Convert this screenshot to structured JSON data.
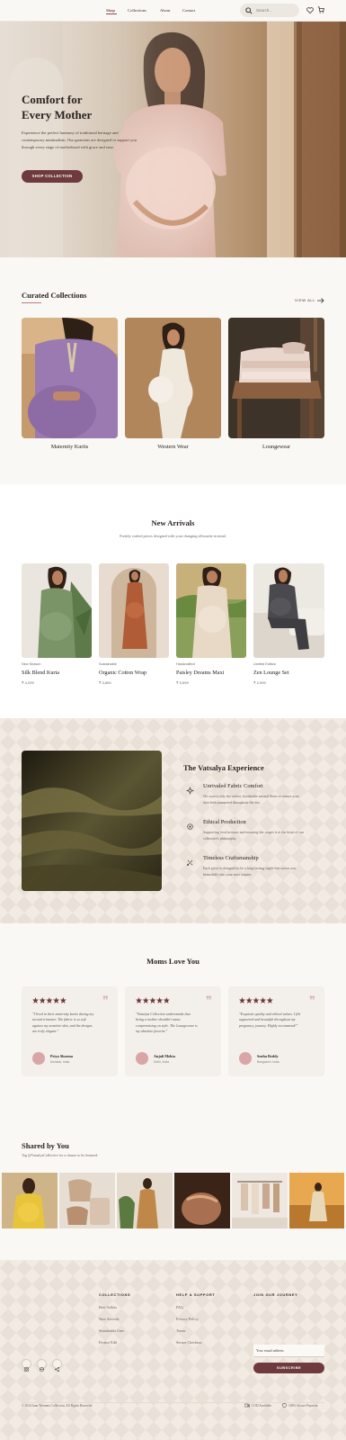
{
  "nav": {
    "items": [
      {
        "label": "Shop"
      },
      {
        "label": "Collections"
      },
      {
        "label": "About"
      },
      {
        "label": "Contact"
      }
    ],
    "search_placeholder": "Search..."
  },
  "hero": {
    "title_line1": "Comfort for",
    "title_line2": "Every Mother",
    "subtitle_line1": "Experience the perfect harmony of traditional heritage and",
    "subtitle_line2": "contemporary minimalism. Our garments are designed to support you",
    "subtitle_line3": "through every stage of motherhood with grace and ease.",
    "cta": "SHOP COLLECTION"
  },
  "curated": {
    "title": "Curated Collections",
    "view_all": "VIEW ALL",
    "items": [
      {
        "label": "Maternity Kurtis"
      },
      {
        "label": "Western Wear"
      },
      {
        "label": "Loungewear"
      }
    ]
  },
  "arrivals": {
    "title": "New Arrivals",
    "subtitle": "Freshly crafted pieces designed with your changing silhouette in mind.",
    "products": [
      {
        "tag": "New Season",
        "name": "Silk Blend Kurta",
        "price": "₹ 4,299"
      },
      {
        "tag": "Sustainable",
        "name": "Organic Cotton Wrap",
        "price": "₹ 3,850"
      },
      {
        "tag": "Handcrafted",
        "name": "Paisley Dreams Maxi",
        "price": "₹ 5,599"
      },
      {
        "tag": "Limited Edition",
        "name": "Zen Lounge Set",
        "price": "₹ 2,999"
      }
    ]
  },
  "experience": {
    "title": "The Vatsalya Experience",
    "features": [
      {
        "icon": "sparkle-icon",
        "title": "Unrivaled Fabric Comfort",
        "text1": "We source only the softest, breathable natural fibers to ensure your",
        "text2": "skin feels pampered throughout the day."
      },
      {
        "icon": "leaf-icon",
        "title": "Ethical Production",
        "text1": "Supporting local artisans and ensuring fair wages is at the heart of our",
        "text2": "collective's philosophy."
      },
      {
        "icon": "craft-icon",
        "title": "Timeless Craftsmanship",
        "text1": "Each piece is designed to be a long-lasting staple that serves you",
        "text2": "beautifully into your next chapter."
      }
    ]
  },
  "testimonials": {
    "title": "Moms Love You",
    "items": [
      {
        "q1": "\"I lived in their maternity kurtis during my",
        "q2": "second trimester. The fabric is so soft",
        "q3": "against my sensitive skin, and the designs",
        "q4": "are truly elegant.\"",
        "name": "Priya Sharma",
        "loc": "Mumbai, India"
      },
      {
        "q1": "\"Vatsalya Collection understands that",
        "q2": "being a mother shouldn't mean",
        "q3": "compromising on style. The Loungewear is",
        "q4": "my absolute favorite.\"",
        "name": "Anjali Mehta",
        "loc": "Delhi, India"
      },
      {
        "q1": "\"Exquisite quality and ethical values. I felt",
        "q2": "supported and beautiful throughout my",
        "q3": "pregnancy journey. Highly recommend!\"",
        "q4": "",
        "name": "Sneha Reddy",
        "loc": "Bangalore, India"
      }
    ]
  },
  "shared": {
    "title": "Shared by You",
    "subtitle": "Tag @VatsalyaCollective for a chance to be featured."
  },
  "footer": {
    "collections_title": "COLLECTIONS",
    "collections": [
      "Best Sellers",
      "New Arrivals",
      "Sustainable Line",
      "Festive Edit"
    ],
    "help_title": "HELP & SUPPORT",
    "help": [
      "FAQ",
      "Privacy Policy",
      "Terms",
      "Secure Checkout"
    ],
    "join_title": "JOIN OUR JOURNEY",
    "email_placeholder": "Your email address",
    "subscribe": "SUBSCRIBE",
    "copyright": "© 2024 Janu Womens Collection. All Rights Reserved.",
    "badge1": "COD Available",
    "badge2": "100% Secure Payment"
  },
  "colors": {
    "accent": "#6e3a3d",
    "background": "#faf8f4",
    "card": "#f3efea"
  }
}
